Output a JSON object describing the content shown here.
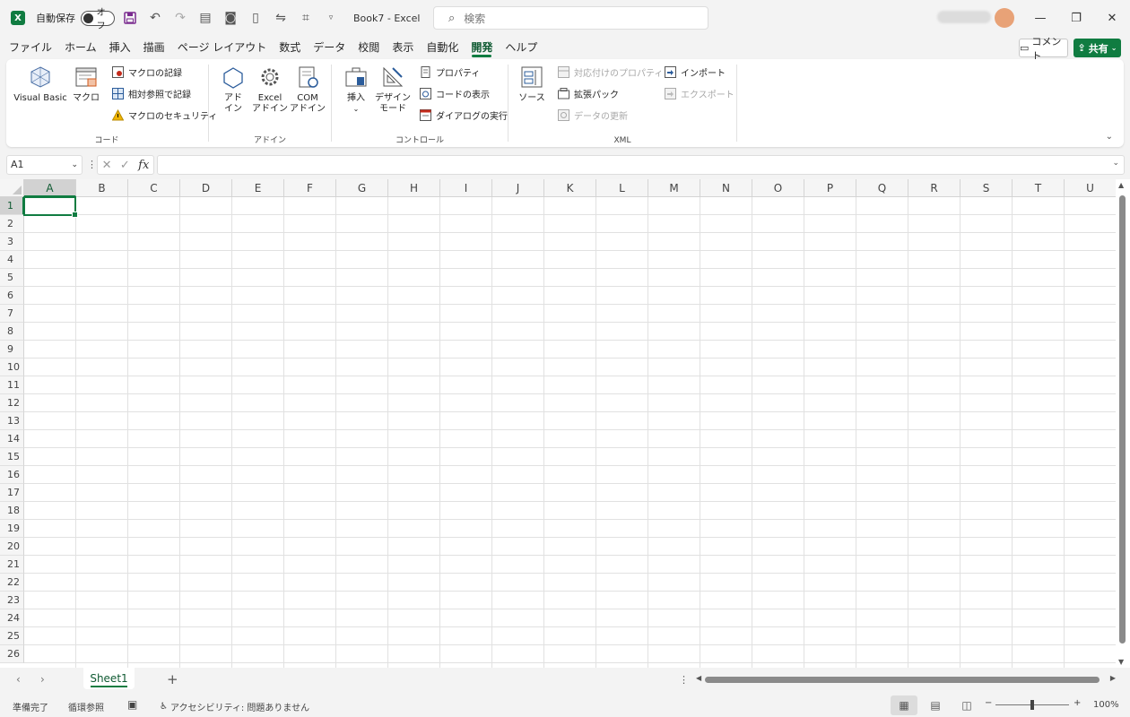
{
  "titlebar": {
    "app_icon": "X",
    "autosave_label": "自動保存",
    "autosave_state": "オフ",
    "book_title": "Book7  -  Excel",
    "search_placeholder": "検索",
    "minimize": "—",
    "restore": "❐",
    "close": "✕"
  },
  "menu": {
    "tabs": [
      "ファイル",
      "ホーム",
      "挿入",
      "描画",
      "ページ レイアウト",
      "数式",
      "データ",
      "校閲",
      "表示",
      "自動化",
      "開発",
      "ヘルプ"
    ],
    "active_tab": "開発",
    "comment_label": "コメント",
    "share_label": "共有"
  },
  "ribbon": {
    "code": {
      "label": "コード",
      "visual_basic": "Visual Basic",
      "macro": "マクロ",
      "record_macro": "マクロの記録",
      "relative_ref": "相対参照で記録",
      "macro_security": "マクロのセキュリティ"
    },
    "addins": {
      "label": "アドイン",
      "addin": "アド\nイン",
      "excel_addin": "Excel\nアドイン",
      "com_addin": "COM\nアドイン"
    },
    "controls": {
      "label": "コントロール",
      "insert": "挿入",
      "design_mode": "デザイン\nモード",
      "properties": "プロパティ",
      "view_code": "コードの表示",
      "run_dialog": "ダイアログの実行"
    },
    "xml": {
      "label": "XML",
      "source": "ソース",
      "map_properties": "対応付けのプロパティ",
      "expansion_packs": "拡張パック",
      "refresh_data": "データの更新",
      "import": "インポート",
      "export": "エクスポート"
    }
  },
  "formula_bar": {
    "name_box": "A1",
    "fx": "fx",
    "value": ""
  },
  "grid": {
    "columns": [
      "A",
      "B",
      "C",
      "D",
      "E",
      "F",
      "G",
      "H",
      "I",
      "J",
      "K",
      "L",
      "M",
      "N",
      "O",
      "P",
      "Q",
      "R",
      "S",
      "T",
      "U"
    ],
    "rows": [
      "1",
      "2",
      "3",
      "4",
      "5",
      "6",
      "7",
      "8",
      "9",
      "10",
      "11",
      "12",
      "13",
      "14",
      "15",
      "16",
      "17",
      "18",
      "19",
      "20",
      "21",
      "22",
      "23",
      "24",
      "25",
      "26"
    ],
    "active_cell": "A1"
  },
  "sheets": {
    "tabs": [
      "Sheet1"
    ],
    "add_label": "+"
  },
  "status": {
    "ready": "準備完了",
    "circular_ref": "循環参照",
    "accessibility": "アクセシビリティ: 問題ありません",
    "zoom_minus": "−",
    "zoom_plus": "+",
    "zoom": "100%"
  },
  "colors": {
    "accent": "#107c41",
    "save_icon": "#7a2b8f"
  }
}
